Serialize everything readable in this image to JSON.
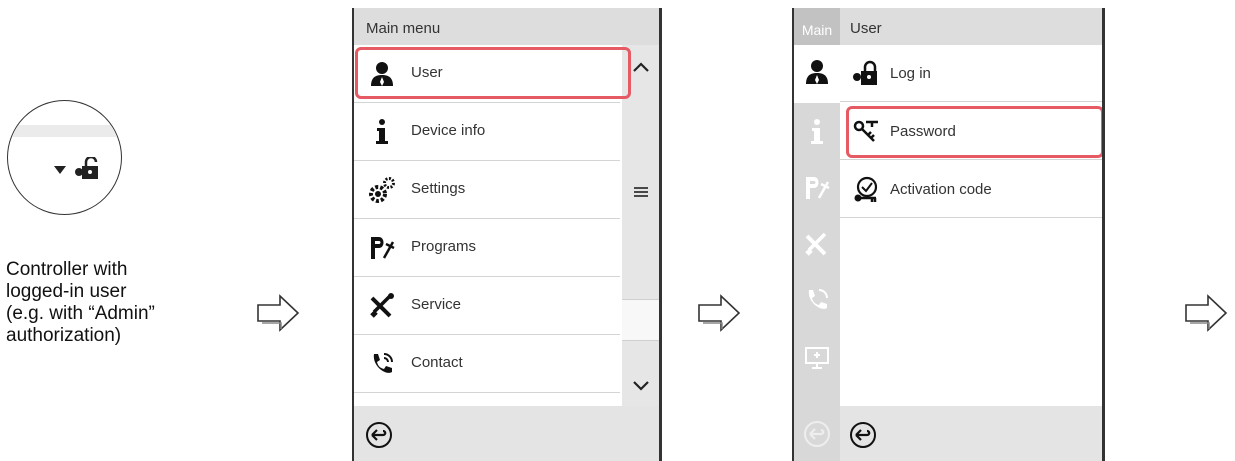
{
  "caption": {
    "line1": "Controller with",
    "line2": "logged-in user",
    "line3": "(e.g. with “Admin”",
    "line4": "authorization)"
  },
  "main_menu": {
    "title": "Main menu",
    "items": [
      {
        "label": "User",
        "icon": "user-icon"
      },
      {
        "label": "Device info",
        "icon": "info-icon"
      },
      {
        "label": "Settings",
        "icon": "gears-icon"
      },
      {
        "label": "Programs",
        "icon": "programs-icon"
      },
      {
        "label": "Service",
        "icon": "tools-icon"
      },
      {
        "label": "Contact",
        "icon": "phone-icon"
      }
    ]
  },
  "user_menu": {
    "sidebar_title": "Main",
    "title": "User",
    "items": [
      {
        "label": "Log in",
        "icon": "login-lock-icon"
      },
      {
        "label": "Password",
        "icon": "key-icon"
      },
      {
        "label": "Activation code",
        "icon": "activation-code-icon"
      }
    ]
  },
  "colors": {
    "highlight": "#e65a64",
    "bar": "#dddddd",
    "sidebar": "#d8d8d8"
  }
}
